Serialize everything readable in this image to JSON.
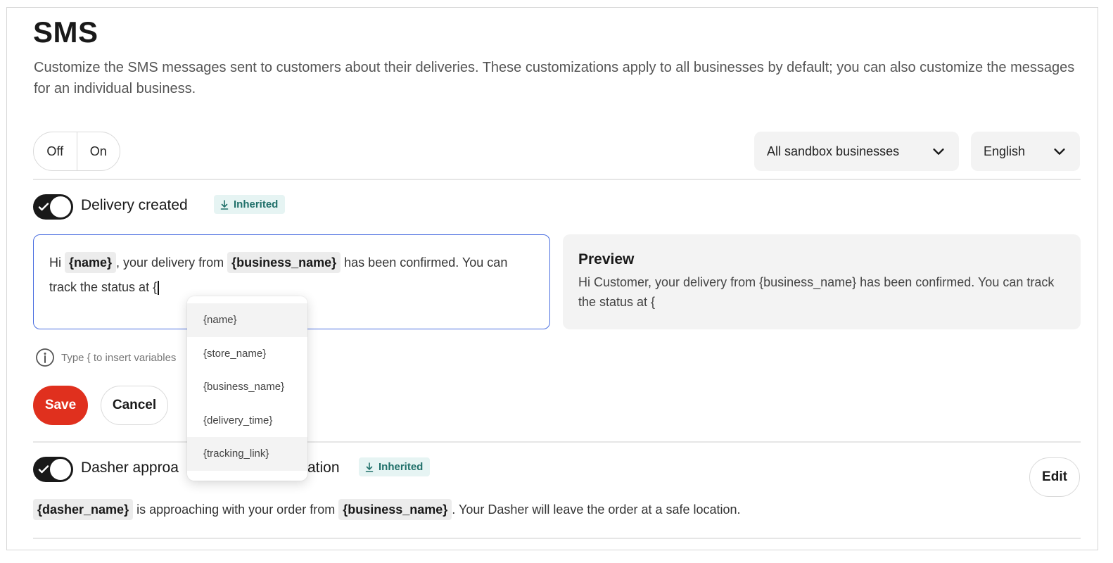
{
  "page": {
    "title": "SMS",
    "description": "Customize the SMS messages sent to customers about their deliveries. These customizations apply to all businesses by default; you can also customize the messages for an individual business."
  },
  "controls": {
    "off_label": "Off",
    "on_label": "On",
    "business_select": "All sandbox businesses",
    "language_select": "English"
  },
  "delivery_created": {
    "label": "Delivery created",
    "badge": "Inherited",
    "enabled": true,
    "editor": {
      "t1": "Hi ",
      "v1": "{name}",
      "t2": ", your delivery from ",
      "v2": "{business_name}",
      "t3": " has been confirmed. You can track the status at {"
    },
    "preview_title": "Preview",
    "preview_text": "Hi Customer, your delivery from {business_name} has been confirmed. You can track the status at {",
    "hint": "Type { to insert variables",
    "save_label": "Save",
    "cancel_label": "Cancel"
  },
  "variable_menu": {
    "items": [
      "{name}",
      "{store_name}",
      "{business_name}",
      "{delivery_time}",
      "{tracking_link}"
    ],
    "highlighted": [
      "{name}",
      "{tracking_link}"
    ]
  },
  "dasher_approaching": {
    "label_start": "Dasher approa",
    "label_end": "ation",
    "badge": "Inherited",
    "enabled": true,
    "message": {
      "v1": "{dasher_name}",
      "t1": " is approaching with your order from ",
      "v2": "{business_name}",
      "t2": ". Your Dasher will leave the order at a safe location."
    },
    "edit_label": "Edit"
  },
  "icons": {
    "chevron": "chevron-down-icon",
    "check": "check-icon",
    "inherited": "inherit-arrow-icon",
    "info": "info-icon"
  }
}
